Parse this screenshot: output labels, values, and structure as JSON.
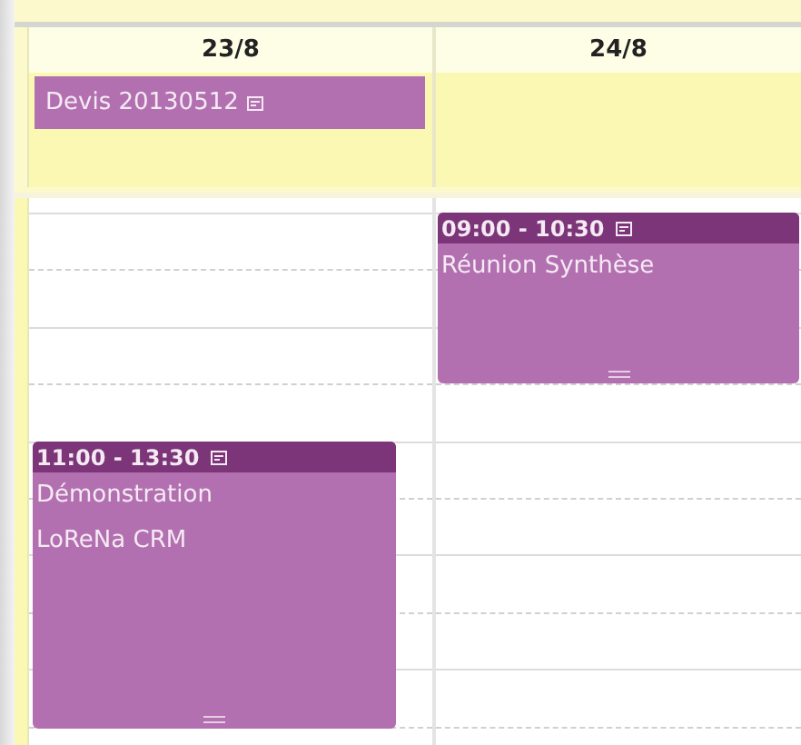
{
  "days": [
    {
      "label": "23/8",
      "all_day_events": [
        {
          "title": "Devis 20130512"
        }
      ],
      "events": [
        {
          "time": "11:00 - 13:30",
          "title": "Démonstration LoReNa CRM"
        }
      ]
    },
    {
      "label": "24/8",
      "events": [
        {
          "time": "09:00 - 10:30",
          "title": "Réunion Synthèse"
        }
      ]
    }
  ]
}
